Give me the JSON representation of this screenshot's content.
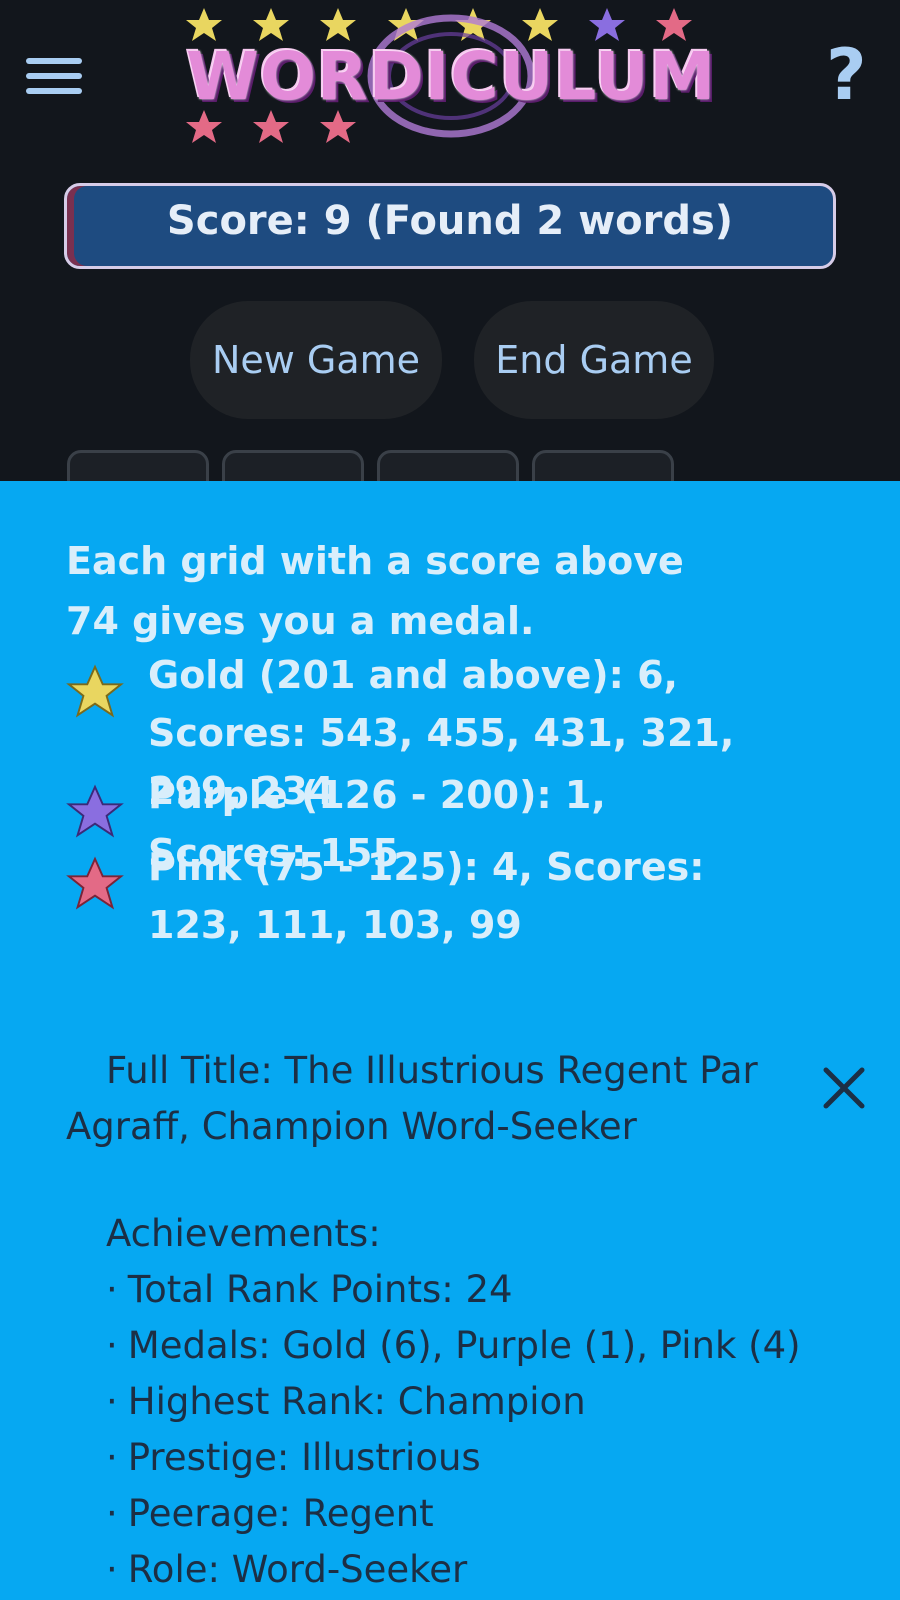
{
  "header": {
    "logo_text": "WORDICULUM",
    "score_text": "Score: 9 (Found 2 words)",
    "help_label": "?",
    "buttons": {
      "new_game": "New Game",
      "end_game": "End Game"
    }
  },
  "colors": {
    "gold": "#e9d660",
    "purple": "#8a6ee0",
    "pink": "#e36a86",
    "panel": "#06a8f2",
    "score_bar": "#1e4b80"
  },
  "panel": {
    "intro": "Each grid with a score above 74 gives you a medal.",
    "medals": [
      {
        "icon": "gold-star-icon",
        "text": "Gold (201 and above): 6, Scores: 543, 455, 431, 321, 299, 234"
      },
      {
        "icon": "purple-star-icon",
        "text": "Purple (126 - 200): 1, Scores: 155"
      },
      {
        "icon": "pink-star-icon",
        "text": "Pink (75 - 125): 4, Scores: 123, 111, 103, 99"
      }
    ],
    "full_title": "Full Title: The Illustrious Regent Par Agraff, Champion Word-Seeker",
    "achievements_heading": "Achievements:",
    "achievements": [
      "Total Rank Points: 24",
      "Medals: Gold (6), Purple (1), Pink (4)",
      "Highest Rank: Champion",
      "Prestige: Illustrious",
      "Peerage: Regent",
      "Role: Word-Seeker"
    ]
  }
}
